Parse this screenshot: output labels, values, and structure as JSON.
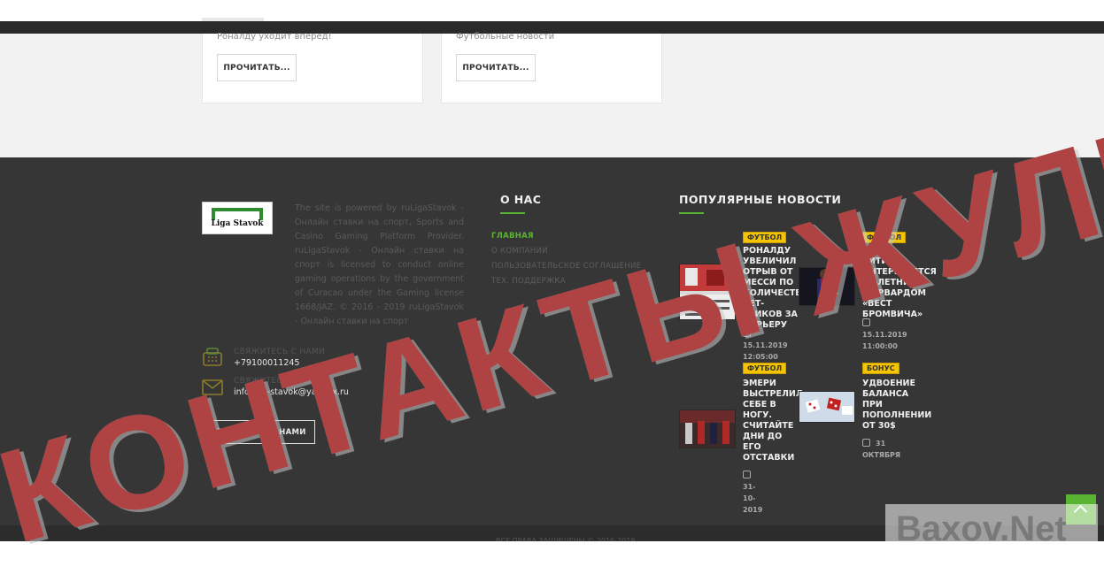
{
  "cards": [
    {
      "excerpt": "Роналду уходит вперед!",
      "button": "ПРОЧИТАТЬ..."
    },
    {
      "excerpt": "Футбольные новости",
      "button": "ПРОЧИТАТЬ..."
    }
  ],
  "footer": {
    "logo_text": "Liga Stavok",
    "about": "The site is powered by ruLigaStavok - Онлайн ставки на спорт, Sports and Casino Gaming Platform Provider. ruLigaStavok - Онлайн ставки на спорт is licensed to conduct online gaming operations by the government of Curacao under the Gaming license 1668/JAZ. © 2016 - 2019 ruLigaStavok - Онлайн ставки на спорт",
    "contacts": [
      {
        "title": "СВЯЖИТЕСЬ С НАМИ",
        "value": "+79100011245",
        "icon": "phone-icon"
      },
      {
        "title": "СВЯЖИТЕСЬ С НАМИ",
        "value": "info.liga-stavok@yandex.ru",
        "icon": "mail-icon"
      }
    ],
    "contact_button": "СВЯЖИТЕСЬ С НАМИ",
    "about_title": "О НАС",
    "menu": [
      "ГЛАВНАЯ",
      "О КОМПАНИИ",
      "ПОЛЬЗОВАТЕЛЬСКОЕ СОГЛАШЕНИЕ",
      "ТЕХ. ПОДДЕРЖКА"
    ],
    "news_title": "ПОПУЛЯРНЫЕ НОВОСТИ",
    "news": [
      {
        "tag": "ФУТБОЛ",
        "headline": "РОНАЛДУ УВЕЛИЧИЛ ОТРЫВ ОТ МЕССИ ПО КОЛИЧЕСТВУ ХЕТ-ТРИКОВ ЗА КАРЬЕРУ",
        "date": "15.11.2019",
        "time": "12:05:00"
      },
      {
        "tag": "ФУТБОЛ",
        "headline": "«МАН СИТИ» ИНТЕРЕСУЕТСЯ 16-ЛЕТНИМ ФОРВАРДОМ «ВЕСТ БРОМВИЧА»",
        "date": "15.11.2019",
        "time": "11:00:00"
      },
      {
        "tag": "ФУТБОЛ",
        "headline": "ЭМЕРИ ВЫСТРЕЛИЛ СЕБЕ В НОГУ. СЧИТАЙТЕ ДНИ ДО ЕГО ОТСТАВКИ",
        "date": "31-10-",
        "time": "2019"
      },
      {
        "tag": "БОНУС",
        "headline": "УДВОЕНИЕ БАЛАНСА ПРИ ПОПОЛНЕНИИ ОТ 30$",
        "date": "31 ОКТЯБРЯ",
        "time": ""
      }
    ],
    "copyright": "ВСЕ ПРАВА ЗАЩИЩЕНЫ © 2016-2019"
  },
  "overlay": {
    "stamp_text": "КОНТАКТЫ ЖУЛИКОВ",
    "site_watermark": "Baxov.Net"
  },
  "colors": {
    "accent_green": "#59b431",
    "tag_yellow": "#f4c400",
    "stamp_red": "#b02828",
    "footer_bg": "#363636"
  }
}
